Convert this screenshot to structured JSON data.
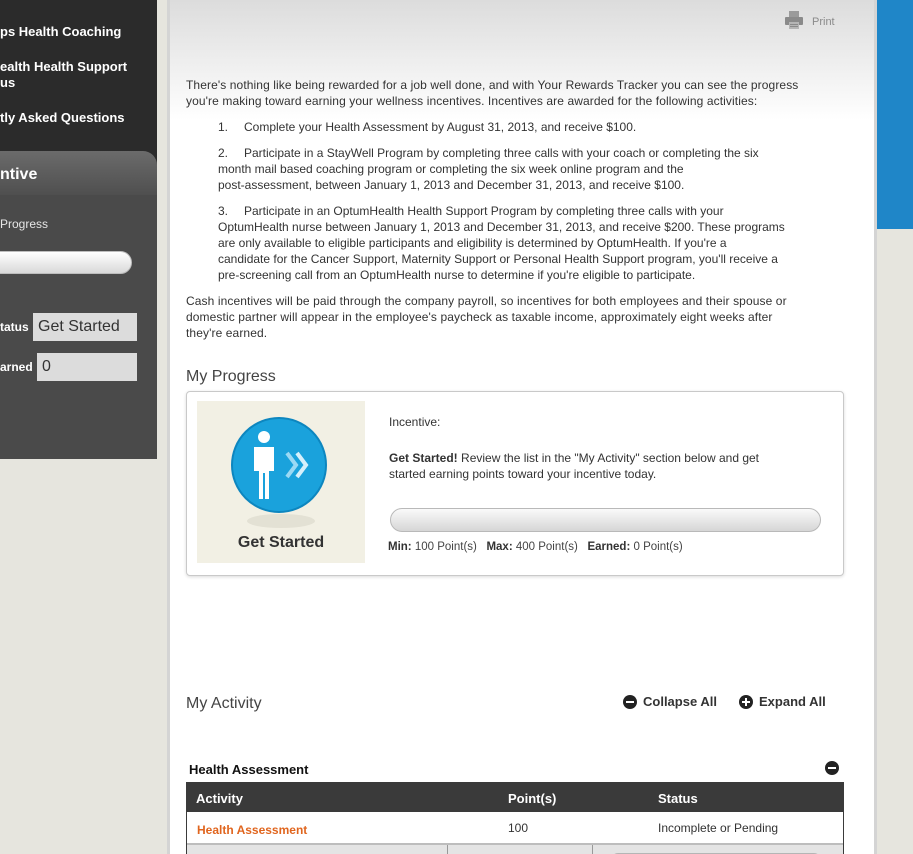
{
  "sidebar": {
    "links": [
      "ps Health Coaching",
      "ealth Health Support",
      "us",
      "tly Asked Questions"
    ],
    "incentive_title": "ntive",
    "progress_label": "Progress",
    "status_label": "tatus",
    "status_value": "Get Started",
    "earned_label": "arned",
    "earned_value": "0"
  },
  "main": {
    "print_label": "Print",
    "intro": [
      "There's nothing like being rewarded for a job well done, and with Your Rewards Tracker you can see the progress",
      "you're making toward earning your wellness incentives. Incentives are awarded for the following activities:"
    ],
    "list": [
      {
        "num": "1.",
        "lines": [
          "Complete your Health Assessment by August 31, 2013, and receive $100."
        ]
      },
      {
        "num": "2.",
        "lines": [
          "Participate in a StayWell Program by completing three calls with your coach or completing the six",
          "month mail based coaching program or completing the six week online program and the",
          "post-assessment, between January 1, 2013 and December 31, 2013, and receive $100."
        ]
      },
      {
        "num": "3.",
        "lines": [
          "Participate in an OptumHealth Health Support Program by completing three calls with your",
          "OptumHealth nurse between January 1, 2013 and December 31, 2013, and receive $200. These programs",
          "are only available to eligible participants and eligibility is determined by OptumHealth. If you're a",
          "candidate for the Cancer Support, Maternity Support or Personal Health Support program, you'll receive a",
          "pre-screening call from an OptumHealth nurse to determine if you're eligible to participate."
        ]
      }
    ],
    "cash": [
      "Cash incentives will be paid through the company payroll, so incentives for both employees and their spouse or",
      "domestic partner will appear in the employee's paycheck as taxable income, approximately eight weeks after",
      "they're earned."
    ]
  },
  "progress": {
    "heading": "My Progress",
    "badge_label": "Get Started",
    "incentive_label": "Incentive:",
    "get_started_bold": "Get Started!",
    "get_started_text_1": " Review the list in the \"My Activity\" section below and get",
    "get_started_text_2": "started earning points toward your incentive today.",
    "min_label": "Min:",
    "min_value": "100 Point(s)",
    "max_label": "Max:",
    "max_value": "400 Point(s)",
    "earned_label": "Earned:",
    "earned_value": "0 Point(s)",
    "fill_fraction": 0
  },
  "activity": {
    "heading": "My Activity",
    "collapse_all": "Collapse All",
    "expand_all": "Expand All",
    "section_title": "Health Assessment",
    "columns": [
      "Activity",
      "Point(s)",
      "Status"
    ],
    "rows": [
      {
        "activity": "Health Assessment",
        "points": "100",
        "status": "Incomplete or Pending"
      }
    ]
  },
  "colors": {
    "sidebar_bg": "#2b2b2b",
    "accent_blue": "#1f86c8",
    "activity_link": "#e0651e",
    "table_header": "#3a3a3a"
  }
}
